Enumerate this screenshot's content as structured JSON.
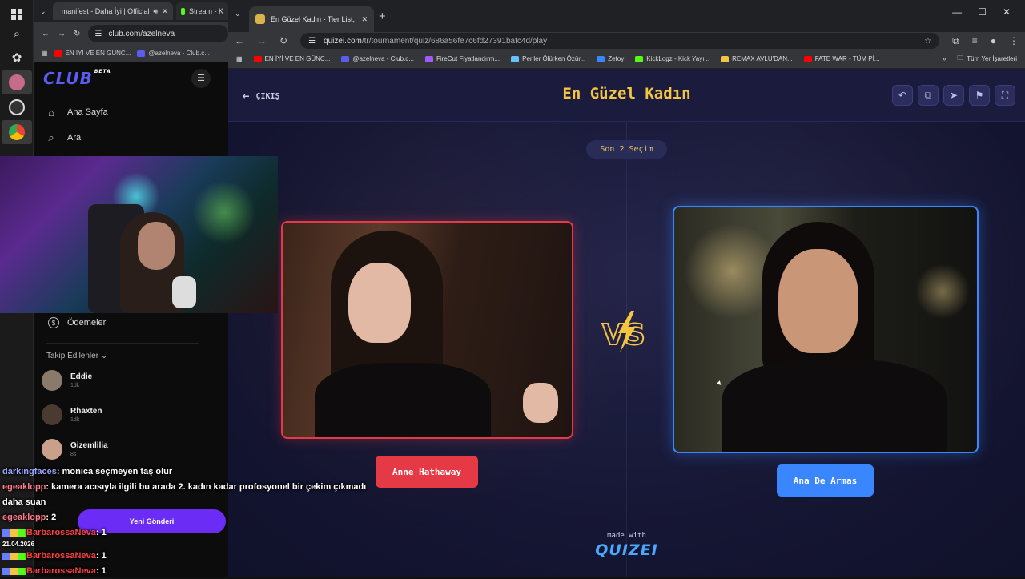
{
  "left_browser": {
    "tabs": [
      {
        "label": "manifest - Daha İyi | Official"
      },
      {
        "label": "Stream - K"
      }
    ],
    "url": "club.com/azelneva",
    "bookmarks": [
      "EN İYİ VE EN GÜNC...",
      "@azelneva - Club.c..."
    ],
    "club": {
      "logo": "CLUB",
      "beta": "BETA",
      "nav": [
        {
          "label": "Ana Sayfa",
          "icon": "home-icon"
        },
        {
          "label": "Ara",
          "icon": "search-icon"
        }
      ],
      "payments": "Ödemeler",
      "following_title": "Takip Edilenler",
      "following": [
        {
          "name": "Eddie",
          "sub": "1dk"
        },
        {
          "name": "Rhaxten",
          "sub": "1dk"
        },
        {
          "name": "Gizemlilia",
          "sub": "8s"
        }
      ],
      "new_post": "Yeni Gönderi"
    }
  },
  "chat": [
    {
      "user": "darkingfaces",
      "text": ": monica seçmeyen taş olur"
    },
    {
      "user": "egeaklopp",
      "text": ": kamera acısıyla ilgili bu arada 2. kadın kadar profosyonel bir çekim çıkmadı"
    },
    {
      "user": "",
      "text": "daha suan"
    },
    {
      "user": "egeaklopp",
      "text": ": 2"
    },
    {
      "user": "BarbarossaNeva",
      "text": ": 1"
    },
    {
      "user": "BarbarossaNeva",
      "text": ": 1"
    },
    {
      "user": "BarbarossaNeva",
      "text": ": 1"
    }
  ],
  "chat_date": "21.04.2026",
  "right_browser": {
    "tab_title": "En Güzel Kadın - Tier List, Kör S",
    "url_host": "quizei.com",
    "url_path": "/tr/tournament/quiz/686a56fe7c6fd27391bafc4d/play",
    "bookmarks": [
      {
        "label": "EN İYİ VE EN GÜNC...",
        "color": "#ff0000"
      },
      {
        "label": "@azelneva - Club.c...",
        "color": "#5b5cf0"
      },
      {
        "label": "FireCut Fiyatlandırm...",
        "color": "#a259ff"
      },
      {
        "label": "Periler Ölürken Özür...",
        "color": "#66c2ff"
      },
      {
        "label": "Zefoy",
        "color": "#3a86ff"
      },
      {
        "label": "KickLogz - Kick Yayı...",
        "color": "#53fc18"
      },
      {
        "label": "REMAX AVLU'DAN...",
        "color": "#f5c542"
      },
      {
        "label": "FATE WAR - TÜM Pİ...",
        "color": "#ff0000"
      }
    ],
    "all_bookmarks": "Tüm Yer İşaretleri"
  },
  "quiz": {
    "exit_label": "ÇIKIŞ",
    "title": "En Güzel Kadın",
    "round": "Son 2 Seçim",
    "left_name": "Anne Hathaway",
    "right_name": "Ana De Armas",
    "made_with": "made with",
    "brand": "QUIZEI",
    "colors": {
      "left": "#e63946",
      "right": "#3a86ff",
      "title": "#f5c542"
    },
    "tools": [
      "undo-icon",
      "copy-icon",
      "share-icon",
      "flag-icon",
      "fullscreen-icon"
    ]
  }
}
